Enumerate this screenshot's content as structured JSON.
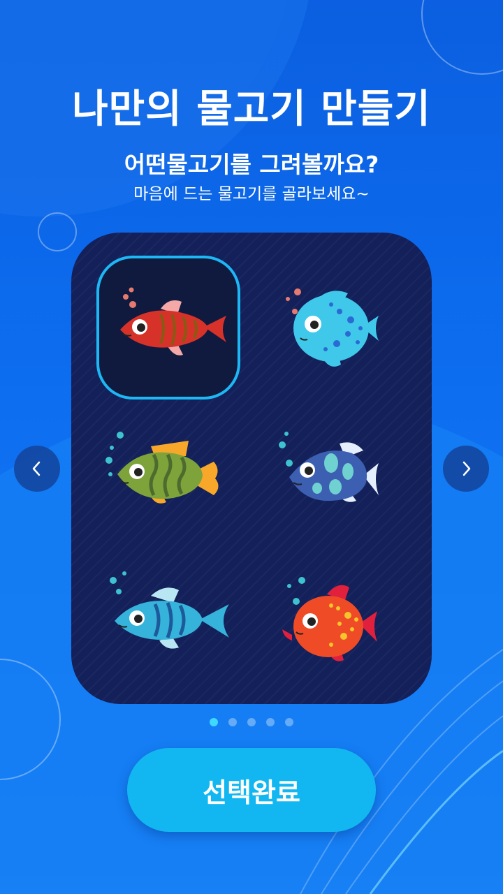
{
  "header": {
    "title": "나만의 물고기 만들기",
    "subtitle": "어떤물고기를 그려볼까요?",
    "description": "마음에 드는 물고기를 골라보세요~"
  },
  "fish_grid": {
    "selected_index": 0,
    "items": [
      {
        "name": "red-striped-fish",
        "body_color": "#d7322a",
        "selected": true
      },
      {
        "name": "blue-spotted-pufferfish",
        "body_color": "#3fc8ea",
        "selected": false
      },
      {
        "name": "green-wavy-fish",
        "body_color": "#7ea33a",
        "selected": false
      },
      {
        "name": "navy-patterned-fish",
        "body_color": "#3c5fb2",
        "selected": false
      },
      {
        "name": "cyan-striped-fish",
        "body_color": "#36b3da",
        "selected": false
      },
      {
        "name": "orange-spotted-fish",
        "body_color": "#ee4b26",
        "selected": false
      }
    ]
  },
  "navigation": {
    "prev_icon": "chevron-left-icon",
    "next_icon": "chevron-right-icon"
  },
  "pagination": {
    "total": 5,
    "current": 1
  },
  "footer": {
    "complete_label": "선택완료"
  },
  "colors": {
    "background": "#0d6ef0",
    "panel": "#13205a",
    "accent": "#1eb7f5",
    "button": "#12b7f2"
  }
}
